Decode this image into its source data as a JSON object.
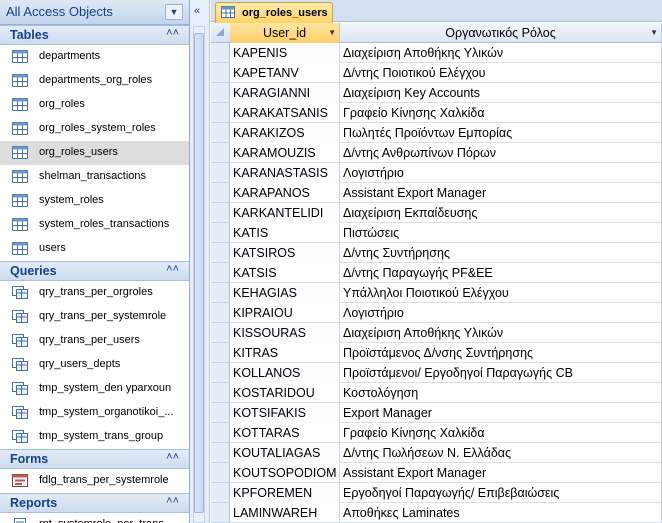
{
  "nav": {
    "title": "All Access Objects",
    "groups": [
      {
        "label": "Tables",
        "items": [
          "departments",
          "departments_org_roles",
          "org_roles",
          "org_roles_system_roles",
          "org_roles_users",
          "shelman_transactions",
          "system_roles",
          "system_roles_transactions",
          "users"
        ]
      },
      {
        "label": "Queries",
        "items": [
          "qry_trans_per_orgroles",
          "qry_trans_per_systemrole",
          "qry_trans_per_users",
          "qry_users_depts",
          "tmp_system_den yparxoun",
          "tmp_system_organotikoi_...",
          "tmp_system_trans_group"
        ]
      },
      {
        "label": "Forms",
        "items": [
          "fdlg_trans_per_systemrole"
        ]
      },
      {
        "label": "Reports",
        "items": [
          "rpt_systemrole_per_trans"
        ]
      }
    ]
  },
  "tab": {
    "label": "org_roles_users"
  },
  "grid": {
    "columns": [
      "User_id",
      "Οργανωτικός Ρόλος"
    ],
    "rows": [
      [
        "KAPENIS",
        "Διαχείριση Αποθήκης Υλικών"
      ],
      [
        "KAPETANV",
        "Δ/ντης Ποιοτικού Ελέγχου"
      ],
      [
        "KARAGIANNI",
        "Διαχείριση Key Accounts"
      ],
      [
        "KARAKATSANIS",
        "Γραφείο Κίνησης Χαλκίδα"
      ],
      [
        "KARAKIZOS",
        "Πωλητές Προϊόντων Εμπορίας"
      ],
      [
        "KARAMOUZIS",
        "Δ/ντης Ανθρωπίνων Πόρων"
      ],
      [
        "KARANASTASIS",
        "Λογιστήριο"
      ],
      [
        "KARAPANOS",
        "Assistant Export Manager"
      ],
      [
        "KARKANTELIDI",
        "Διαχείριση Εκπαίδευσης"
      ],
      [
        "KATIS",
        "Πιστώσεις"
      ],
      [
        "KATSIROS",
        "Δ/ντης Συντήρησης"
      ],
      [
        "KATSIS",
        "Δ/ντης Παραγωγής PF&EE"
      ],
      [
        "KEHAGIAS",
        "Υπάλληλοι Ποιοτικού Ελέγχου"
      ],
      [
        "KIPRAIOU",
        "Λογιστήριο"
      ],
      [
        "KISSOURAS",
        "Διαχείριση Αποθήκης Υλικών"
      ],
      [
        "KITRAS",
        "Προϊστάμενος Δ/νσης Συντήρησης"
      ],
      [
        "KOLLANOS",
        "Προϊστάμενοι/ Εργοδηγοί Παραγωγής CB"
      ],
      [
        "KOSTARIDOU",
        "Κοστολόγηση"
      ],
      [
        "KOTSIFAKIS",
        "Export Manager"
      ],
      [
        "KOTTARAS",
        "Γραφείο Κίνησης Χαλκίδα"
      ],
      [
        "KOUTALIAGAS",
        "Δ/ντης Πωλήσεων Ν. Ελλάδας"
      ],
      [
        "KOUTSOPODIOM",
        "Assistant Export Manager"
      ],
      [
        "KPFOREMEN",
        "Εργοδηγοί Παραγωγής/ Επιβεβαιώσεις"
      ],
      [
        "LAMINWAREH",
        "Αποθήκες Laminates"
      ]
    ]
  },
  "colors": {
    "nav_text": "#15428b",
    "tab_active": "#ffd36a",
    "selected_item": "#dddddd"
  }
}
